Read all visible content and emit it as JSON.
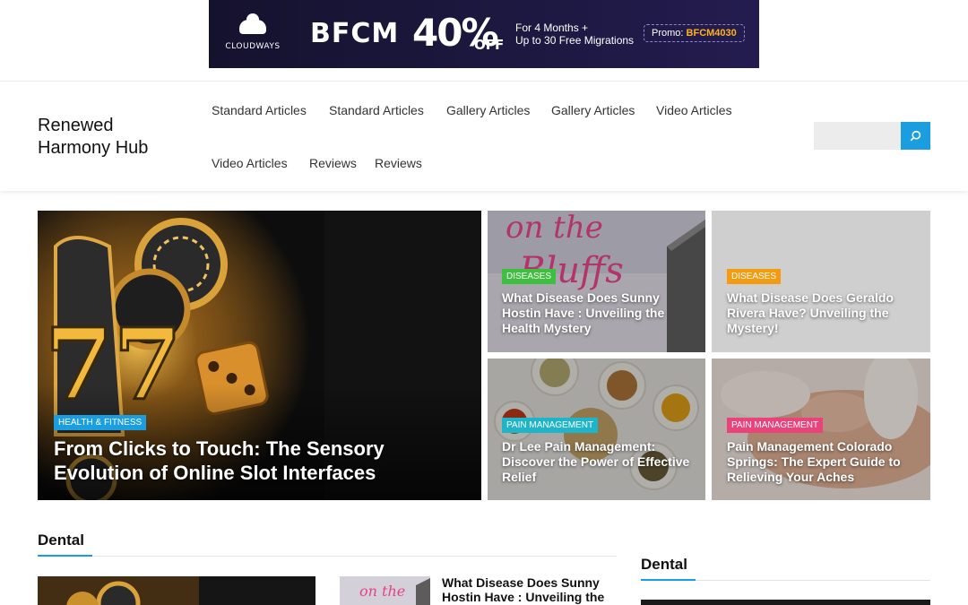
{
  "ad": {
    "brand": "CLOUDWAYS",
    "event": "BFCM",
    "discount": "40%",
    "discount_suffix": "OFF",
    "offer_line1": "For 4 Months +",
    "offer_line2": "Up to 30 Free Migrations",
    "promo_label": "Promo:",
    "promo_code": "BFCM4030",
    "colors": {
      "bg": "#1c1840",
      "accent": "#ffb21d"
    }
  },
  "header": {
    "site_title": "Renewed Harmony Hub",
    "nav": [
      "Standard Articles",
      "Standard Articles",
      "Gallery Articles",
      "Gallery Articles",
      "Video Articles",
      "Video Articles",
      "Reviews",
      "Reviews"
    ],
    "search": {
      "placeholder": "",
      "icon": "search-icon"
    }
  },
  "hero": {
    "main": {
      "category": "HEALTH & FITNESS",
      "title": "From Clicks to Touch: The Sensory Evolution of Online Slot Interfaces",
      "badge_color": "#1a9ee0"
    },
    "tiles": [
      {
        "category": "DISEASES",
        "title": "What Disease Does Sunny Hostin Have : Unveiling the Health Mystery",
        "badge_color": "#3fbf3f"
      },
      {
        "category": "DISEASES",
        "title": "What Disease Does Geraldo Rivera Have? Unveiling the Mystery!",
        "badge_color": "#f39c12"
      },
      {
        "category": "PAIN MANAGEMENT",
        "title": "Dr Lee Pain Management: Discover the Power of Effective Relief",
        "badge_color": "#1fb5c9"
      },
      {
        "category": "PAIN MANAGEMENT",
        "title": "Pain Management Colorado Springs: The Expert Guide to Relieving Your Aches",
        "badge_color": "#e8437a"
      }
    ]
  },
  "sections": {
    "main_heading": "Dental",
    "sidebar_heading": "Dental",
    "list_post_title": "What Disease Does Sunny Hostin Have : Unveiling the"
  },
  "colors": {
    "accent": "#1a9ee0"
  }
}
